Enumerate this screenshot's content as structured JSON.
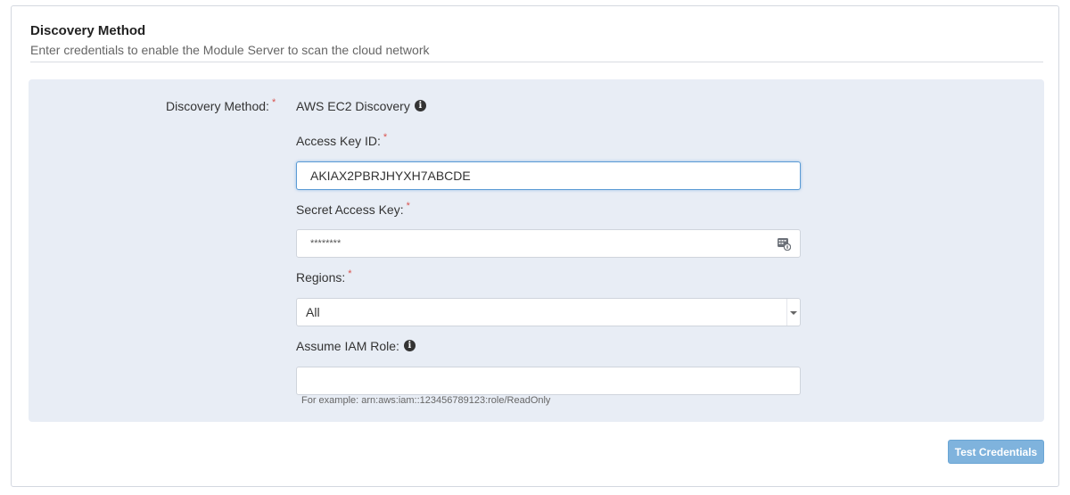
{
  "panel": {
    "title": "Discovery Method",
    "subtitle": "Enter credentials to enable the Module Server to scan the cloud network"
  },
  "form": {
    "discovery_method": {
      "label": "Discovery Method:",
      "required_marker": "*",
      "value": "AWS EC2 Discovery",
      "info_icon": "info-circle-icon"
    },
    "access_key_id": {
      "label": "Access Key ID:",
      "required_marker": "*",
      "value": "AKIAX2PBRJHYXH7ABCDE"
    },
    "secret_access_key": {
      "label": "Secret Access Key:",
      "required_marker": "*",
      "value": "********",
      "icon": "password-manager-icon"
    },
    "regions": {
      "label": "Regions:",
      "required_marker": "*",
      "selected": "All"
    },
    "assume_iam_role": {
      "label": "Assume IAM Role:",
      "info_icon": "info-circle-icon",
      "value": "",
      "helper": "For example: arn:aws:iam::123456789123:role/ReadOnly"
    }
  },
  "actions": {
    "test_credentials_label": "Test Credentials"
  },
  "colors": {
    "form_background": "#e8edf5",
    "focus_border": "#5b9bd5",
    "required": "#d9534f",
    "button": "#7fb3dd"
  }
}
